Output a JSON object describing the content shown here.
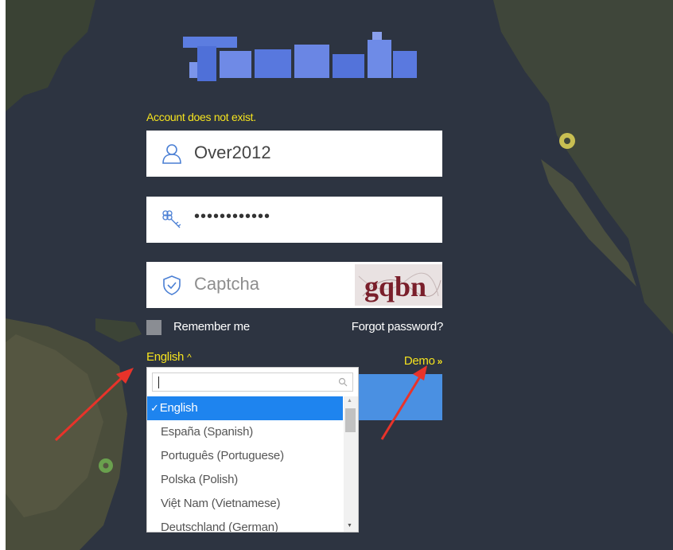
{
  "login": {
    "error_message": "Account does not exist.",
    "username_value": "Over2012",
    "password_value": "••••••••••••",
    "captcha_placeholder": "Captcha",
    "captcha_image_text": "gqbn",
    "remember_label": "Remember me",
    "forgot_label": "Forgot password?",
    "language_label": "English",
    "language_caret": "^",
    "demo_label": "Demo",
    "demo_icon": "»"
  },
  "language_dropdown": {
    "search_value": "",
    "check_mark": "✓",
    "options": [
      "English",
      "España (Spanish)",
      "Português (Portuguese)",
      "Polska (Polish)",
      "Việt Nam (Vietnamese)",
      "Deutschland (German)"
    ],
    "selected": "English"
  },
  "colors": {
    "accent_yellow": "#f5e31e",
    "login_button_blue": "#4a90e2",
    "selected_option_blue": "#1e84ef",
    "map_dark": "#2c3340"
  }
}
